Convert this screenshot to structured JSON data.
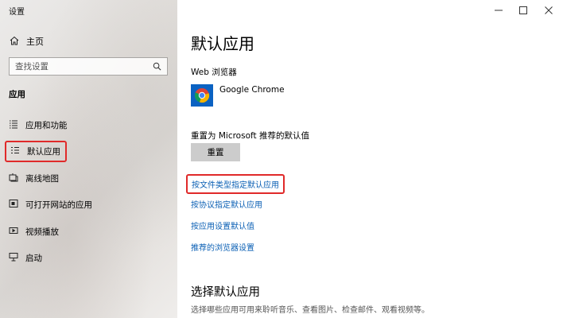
{
  "window": {
    "title": "设置"
  },
  "sidebar": {
    "home_label": "主页",
    "search_placeholder": "查找设置",
    "section_label": "应用",
    "items": [
      {
        "label": "应用和功能",
        "icon": "list-icon"
      },
      {
        "label": "默认应用",
        "icon": "default-apps-icon",
        "active": true
      },
      {
        "label": "离线地图",
        "icon": "map-icon"
      },
      {
        "label": "可打开网站的应用",
        "icon": "open-web-icon"
      },
      {
        "label": "视频播放",
        "icon": "video-icon"
      },
      {
        "label": "启动",
        "icon": "startup-icon"
      }
    ]
  },
  "main": {
    "title": "默认应用",
    "web_browser_label": "Web 浏览器",
    "browser_name": "Google Chrome",
    "reset_label": "重置为 Microsoft 推荐的默认值",
    "reset_button": "重置",
    "links": [
      "按文件类型指定默认应用",
      "按协议指定默认应用",
      "按应用设置默认值",
      "推荐的浏览器设置"
    ],
    "choose_title": "选择默认应用",
    "choose_desc": "选择哪些应用可用来聆听音乐、查看图片、检查邮件、观看视频等。"
  },
  "colors": {
    "accent": "#0067c0",
    "link": "#0a5fb4",
    "highlight": "#e02a2a",
    "button": "#cccccc"
  }
}
